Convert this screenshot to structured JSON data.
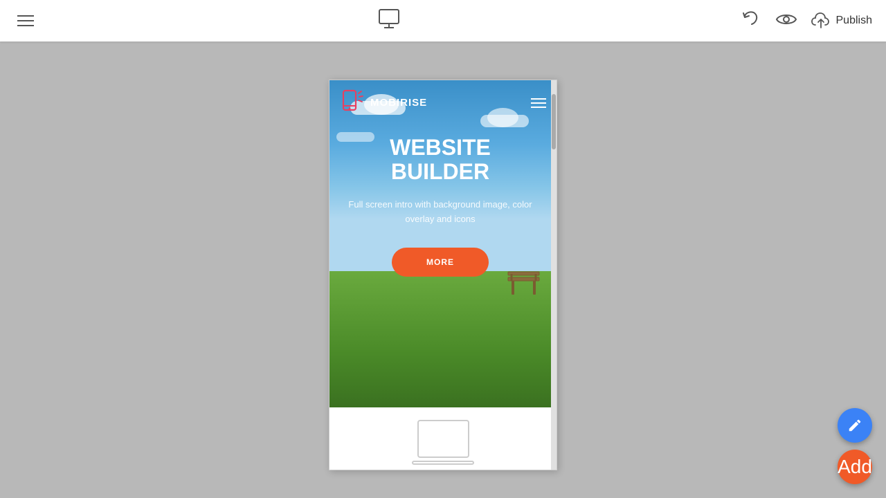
{
  "toolbar": {
    "menu_label": "Menu",
    "publish_label": "Publish",
    "undo_label": "Undo",
    "preview_label": "Preview"
  },
  "preview": {
    "navbar": {
      "logo_text": "MOBIRISE",
      "hamburger_label": "Menu"
    },
    "hero": {
      "title_line1": "WEBSITE",
      "title_line2": "BUILDER",
      "subtitle": "Full screen intro with background image, color overlay and icons",
      "cta_label": "MORE"
    }
  },
  "fab": {
    "edit_label": "Edit",
    "add_label": "Add"
  },
  "icons": {
    "monitor": "monitor-icon",
    "hamburger": "hamburger-icon",
    "undo": "undo-icon",
    "eye": "eye-icon",
    "cloud_upload": "cloud-upload-icon",
    "pencil": "pencil-icon",
    "plus": "plus-icon"
  },
  "colors": {
    "accent_red": "#f05a28",
    "fab_blue": "#3b82f6",
    "hero_sky": "#4a9fd4",
    "hero_grass": "#5a9e3a"
  }
}
